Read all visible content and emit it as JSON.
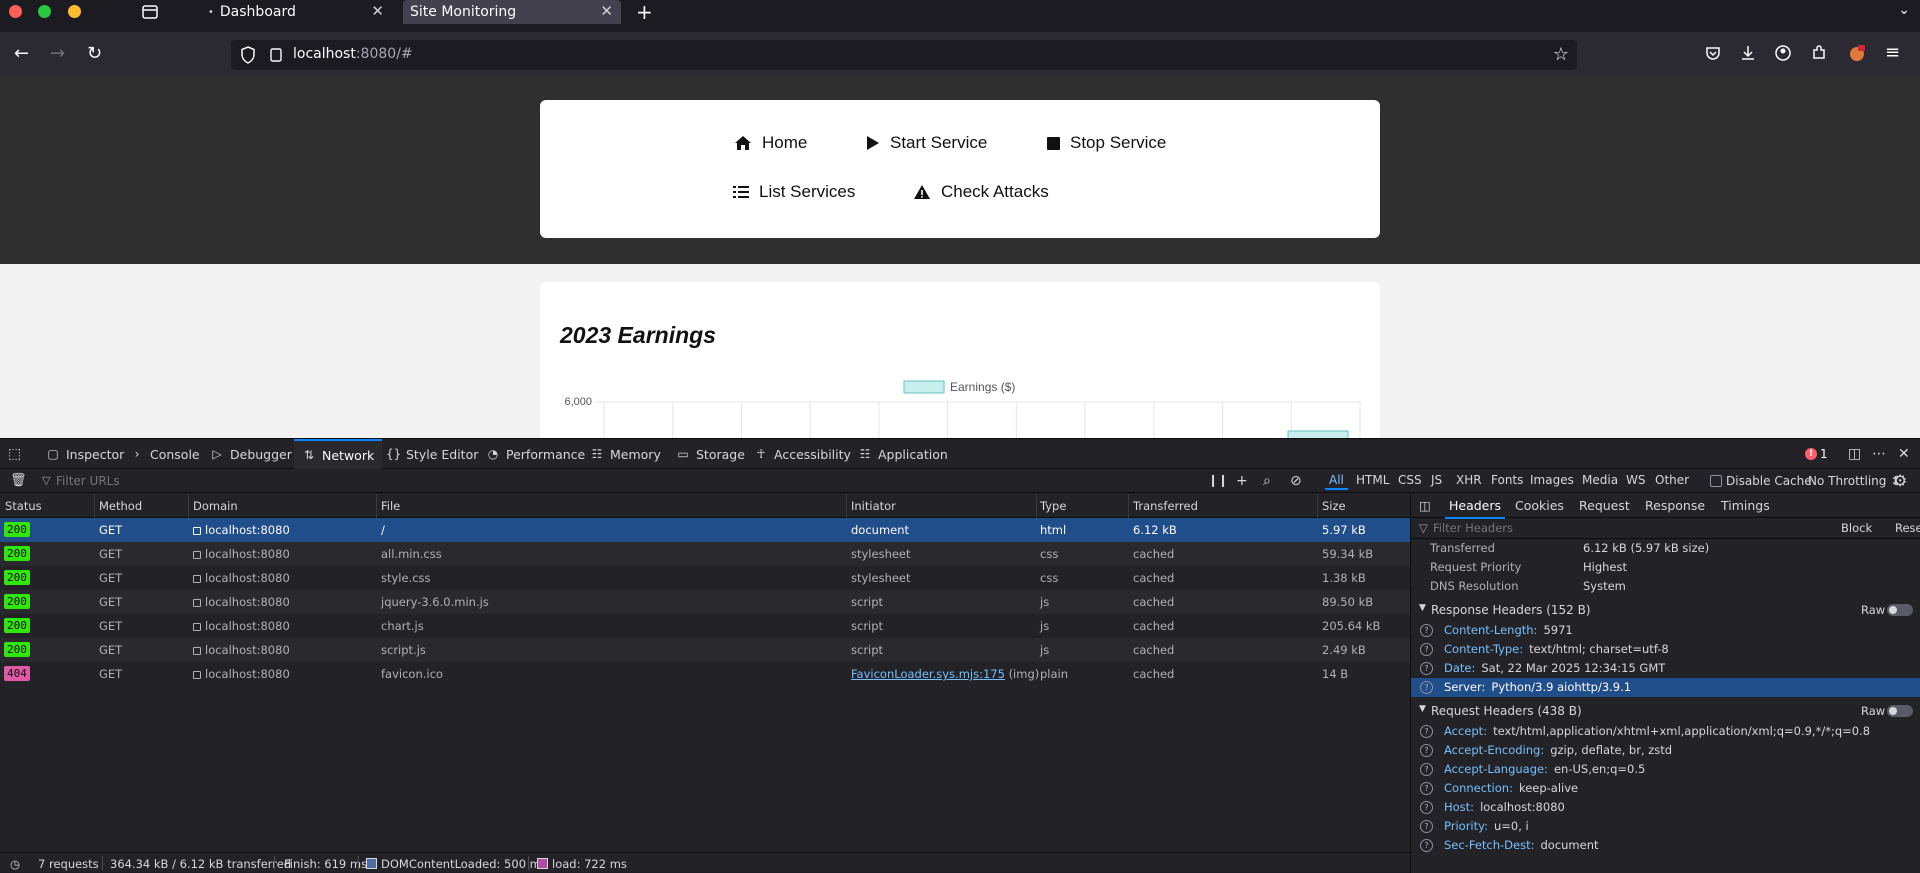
{
  "browser": {
    "tabs": [
      {
        "label": "Dashboard",
        "active": false
      },
      {
        "label": "Site Monitoring",
        "active": true
      }
    ],
    "url_host": "localhost",
    "url_rest": ":8080/#"
  },
  "page": {
    "menu": [
      {
        "label": "Home",
        "icon": "home-icon"
      },
      {
        "label": "Start Service",
        "icon": "play-icon"
      },
      {
        "label": "Stop Service",
        "icon": "stop-icon"
      },
      {
        "label": "List Services",
        "icon": "list-icon"
      },
      {
        "label": "Check Attacks",
        "icon": "warning-icon"
      }
    ],
    "chart_title": "2023 Earnings"
  },
  "chart_data": {
    "type": "bar",
    "title": "2023 Earnings",
    "legend": "Earnings ($)",
    "ytick_visible": "6,000",
    "bar_color": "#c9eeee",
    "border_color": "#5fc3c3"
  },
  "devtools": {
    "tabs": [
      "Inspector",
      "Console",
      "Debugger",
      "Network",
      "Style Editor",
      "Performance",
      "Memory",
      "Storage",
      "Accessibility",
      "Application"
    ],
    "active_tab": "Network",
    "error_count": "1",
    "filter_placeholder": "Filter URLs",
    "type_filters": [
      "All",
      "HTML",
      "CSS",
      "JS",
      "XHR",
      "Fonts",
      "Images",
      "Media",
      "WS",
      "Other"
    ],
    "disable_cache": "Disable Cache",
    "throttling": "No Throttling ↕",
    "columns": [
      "Status",
      "Method",
      "Domain",
      "File",
      "Initiator",
      "Type",
      "Transferred",
      "Size"
    ],
    "requests": [
      {
        "status": "200",
        "method": "GET",
        "domain": "localhost:8080",
        "file": "/",
        "initiator": "document",
        "type": "html",
        "transferred": "6.12 kB",
        "size": "5.97 kB"
      },
      {
        "status": "200",
        "method": "GET",
        "domain": "localhost:8080",
        "file": "all.min.css",
        "initiator": "stylesheet",
        "type": "css",
        "transferred": "cached",
        "size": "59.34 kB"
      },
      {
        "status": "200",
        "method": "GET",
        "domain": "localhost:8080",
        "file": "style.css",
        "initiator": "stylesheet",
        "type": "css",
        "transferred": "cached",
        "size": "1.38 kB"
      },
      {
        "status": "200",
        "method": "GET",
        "domain": "localhost:8080",
        "file": "jquery-3.6.0.min.js",
        "initiator": "script",
        "type": "js",
        "transferred": "cached",
        "size": "89.50 kB"
      },
      {
        "status": "200",
        "method": "GET",
        "domain": "localhost:8080",
        "file": "chart.js",
        "initiator": "script",
        "type": "js",
        "transferred": "cached",
        "size": "205.64 kB"
      },
      {
        "status": "200",
        "method": "GET",
        "domain": "localhost:8080",
        "file": "script.js",
        "initiator": "script",
        "type": "js",
        "transferred": "cached",
        "size": "2.49 kB"
      },
      {
        "status": "404",
        "method": "GET",
        "domain": "localhost:8080",
        "file": "favicon.ico",
        "initiator": "FaviconLoader.sys.mjs:175",
        "initiator_suffix": "(img)",
        "type": "plain",
        "transferred": "cached",
        "size": "14 B"
      }
    ],
    "statusbar": {
      "requests": "7 requests",
      "transferred": "364.34 kB / 6.12 kB transferred",
      "finish": "Finish: 619 ms",
      "dcl": "DOMContentLoaded: 500 ms",
      "load": "load: 722 ms"
    },
    "side": {
      "tabs": [
        "Headers",
        "Cookies",
        "Request",
        "Response",
        "Timings"
      ],
      "filter_placeholder": "Filter Headers",
      "block": "Block",
      "resend": "Resend",
      "info": [
        {
          "k": "Transferred",
          "v": "6.12 kB (5.97 kB size)"
        },
        {
          "k": "Request Priority",
          "v": "Highest"
        },
        {
          "k": "DNS Resolution",
          "v": "System"
        }
      ],
      "response_title": "Response Headers (152 B)",
      "raw": "Raw",
      "response_headers": [
        {
          "k": "Content-Length:",
          "v": "5971"
        },
        {
          "k": "Content-Type:",
          "v": "text/html; charset=utf-8"
        },
        {
          "k": "Date:",
          "v": "Sat, 22 Mar 2025 12:34:15 GMT"
        },
        {
          "k": "Server:",
          "v": "Python/3.9 aiohttp/3.9.1"
        }
      ],
      "request_title": "Request Headers (438 B)",
      "request_headers": [
        {
          "k": "Accept:",
          "v": "text/html,application/xhtml+xml,application/xml;q=0.9,*/*;q=0.8"
        },
        {
          "k": "Accept-Encoding:",
          "v": "gzip, deflate, br, zstd"
        },
        {
          "k": "Accept-Language:",
          "v": "en-US,en;q=0.5"
        },
        {
          "k": "Connection:",
          "v": "keep-alive"
        },
        {
          "k": "Host:",
          "v": "localhost:8080"
        },
        {
          "k": "Priority:",
          "v": "u=0, i"
        },
        {
          "k": "Sec-Fetch-Dest:",
          "v": "document"
        }
      ]
    }
  }
}
